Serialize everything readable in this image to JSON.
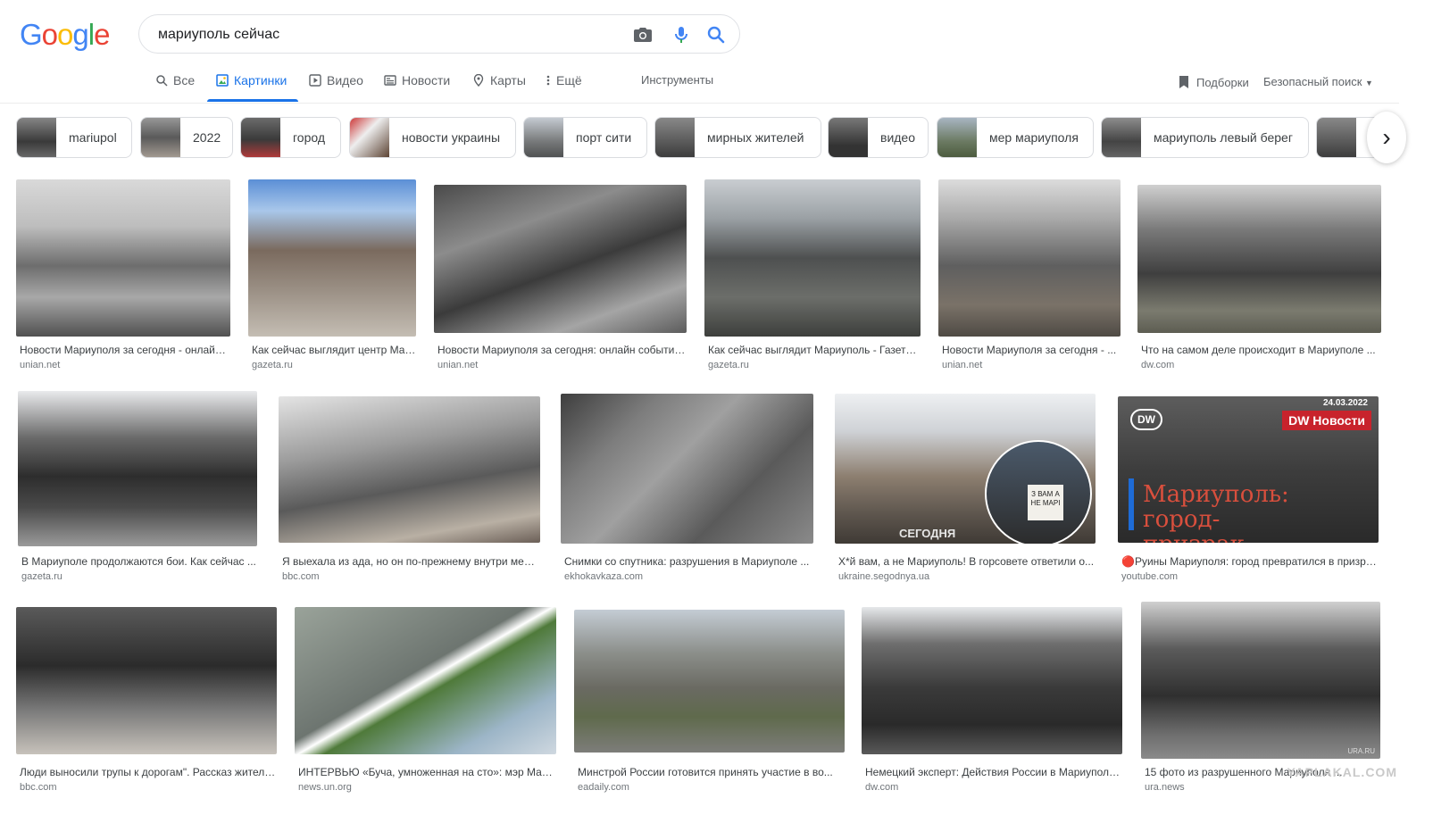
{
  "logo": {
    "letters": [
      "G",
      "o",
      "o",
      "g",
      "l",
      "e"
    ],
    "colors": [
      "#4285f4",
      "#ea4335",
      "#fbbc05",
      "#4285f4",
      "#34a853",
      "#ea4335"
    ]
  },
  "search": {
    "query": "мариуполь сейчас"
  },
  "tabs": [
    {
      "label": "Все",
      "icon": "search-icon",
      "active": false
    },
    {
      "label": "Картинки",
      "icon": "images-icon",
      "active": true
    },
    {
      "label": "Видео",
      "icon": "video-icon",
      "active": false
    },
    {
      "label": "Новости",
      "icon": "news-icon",
      "active": false
    },
    {
      "label": "Карты",
      "icon": "map-pin-icon",
      "active": false
    },
    {
      "label": "Ещё",
      "icon": "more-vert-icon",
      "active": false
    }
  ],
  "tools_label": "Инструменты",
  "collections_label": "Подборки",
  "safesearch_label": "Безопасный поиск",
  "chips": [
    {
      "label": "mariupol"
    },
    {
      "label": "2022"
    },
    {
      "label": "город"
    },
    {
      "label": "новости украины"
    },
    {
      "label": "порт сити"
    },
    {
      "label": "мирных жителей"
    },
    {
      "label": "видео"
    },
    {
      "label": "мер мариуполя"
    },
    {
      "label": "мариуполь левый берег"
    },
    {
      "label": ""
    }
  ],
  "results": [
    {
      "title": "Новости Мариуполя за сегодня - онлайн события ...",
      "source": "unian.net"
    },
    {
      "title": "Как сейчас выглядит центр Мариуполя ...",
      "source": "gazeta.ru"
    },
    {
      "title": "Новости Мариуполя за сегодня: онлайн события ...",
      "source": "unian.net"
    },
    {
      "title": "Как сейчас выглядит Мариуполь - Газета.Ru",
      "source": "gazeta.ru"
    },
    {
      "title": "Новости Мариуполя за сегодня - ...",
      "source": "unian.net"
    },
    {
      "title": "Что на самом деле происходит в Мариуполе ...",
      "source": "dw.com"
    },
    {
      "title": "В Мариуполе продолжаются бои. Как сейчас ...",
      "source": "gazeta.ru"
    },
    {
      "title": "Я выехала из ада, но он по-прежнему внутри меня ...",
      "source": "bbc.com"
    },
    {
      "title": "Снимки со спутника: разрушения в Мариуполе ...",
      "source": "ekhokavkaza.com"
    },
    {
      "title": "Х*й вам, а не Мариуполь! В горсовете ответили о...",
      "source": "ukraine.segodnya.ua"
    },
    {
      "title": "🔴Руины Мариуполя: город превратился в призрак ...",
      "source": "youtube.com"
    },
    {
      "title": "Люди выносили трупы к дорогам\". Рассказ жителя ...",
      "source": "bbc.com"
    },
    {
      "title": "ИНТЕРВЬЮ «Буча, умноженная на сто»: мэр Мариуполя ...",
      "source": "news.un.org"
    },
    {
      "title": "Минстрой России готовится принять участие в во...",
      "source": "eadaily.com"
    },
    {
      "title": "Немецкий эксперт: Действия России в Мариуполе ...",
      "source": "dw.com"
    },
    {
      "title": "15 фото из разрушенного Мариуполя ...",
      "source": "ura.news"
    }
  ],
  "overlays": {
    "yt_date": "24.03.2022",
    "yt_channel": "DW Новости",
    "yt_headline": "Мариуполь: город-призрак",
    "segodnya": "СЕГОДНЯ",
    "dw_logo": "DW",
    "sign_text": "З ВАМ А НЕ МАРІ",
    "watermark": "YAPLAKAL.COM",
    "ura_mark": "URA.RU"
  }
}
